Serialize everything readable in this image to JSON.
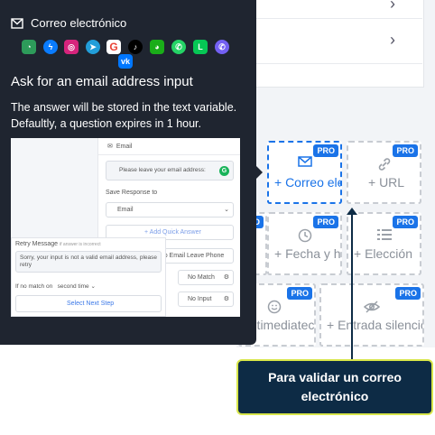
{
  "tooltip": {
    "channel_label": "Correo electrónico",
    "title": "Ask for an email address input",
    "description": "The answer will be stored in the text variable. Defaultly, a question expires in 1 hour."
  },
  "social_icons": [
    "wechat-work-icon",
    "messenger-icon",
    "instagram-icon",
    "telegram-icon",
    "google-icon",
    "tiktok-icon",
    "wechat-icon",
    "whatsapp-icon",
    "line-icon",
    "viber-icon",
    "vk-icon"
  ],
  "preview": {
    "block_name": "Email",
    "prompt": "Please leave your email address:",
    "save_response_label": "Save Response to",
    "variable": "Email",
    "add_quick_answer": "+ Add Quick Answer",
    "skip_button": "Skip Email Leave Phone",
    "no_match": "No Match",
    "no_input": "No Input",
    "retry_label": "Retry Message",
    "retry_hint": "if answer is incorrect",
    "retry_text": "Sorry, your input is not a valid email address, please retry",
    "no_match_label": "If no match on",
    "no_match_value": "second time",
    "select_next_step": "Select Next Step"
  },
  "tiles": [
    {
      "label": "+ Correo electrónico",
      "pro": "PRO",
      "icon": "mail-icon"
    },
    {
      "label": "+ URL",
      "pro": "PRO",
      "icon": "link-icon"
    },
    {
      "label": "+ Fecha y hora",
      "pro": "PRO",
      "icon": "clock-icon"
    },
    {
      "label": "+ Elección",
      "pro": "PRO",
      "icon": "list-icon"
    },
    {
      "label": "Multimediateca",
      "pro": "PRO",
      "icon": "smile-icon"
    },
    {
      "label": "+ Entrada silenciosa",
      "pro": "PRO",
      "icon": "eye-off-icon"
    }
  ],
  "callout": {
    "text": "Para validar un correo electrónico"
  },
  "colors": {
    "tooltip_bg": "#1f2530",
    "accent": "#1a73e8",
    "callout_bg": "#0d2b45",
    "callout_border": "#d8e64a"
  }
}
